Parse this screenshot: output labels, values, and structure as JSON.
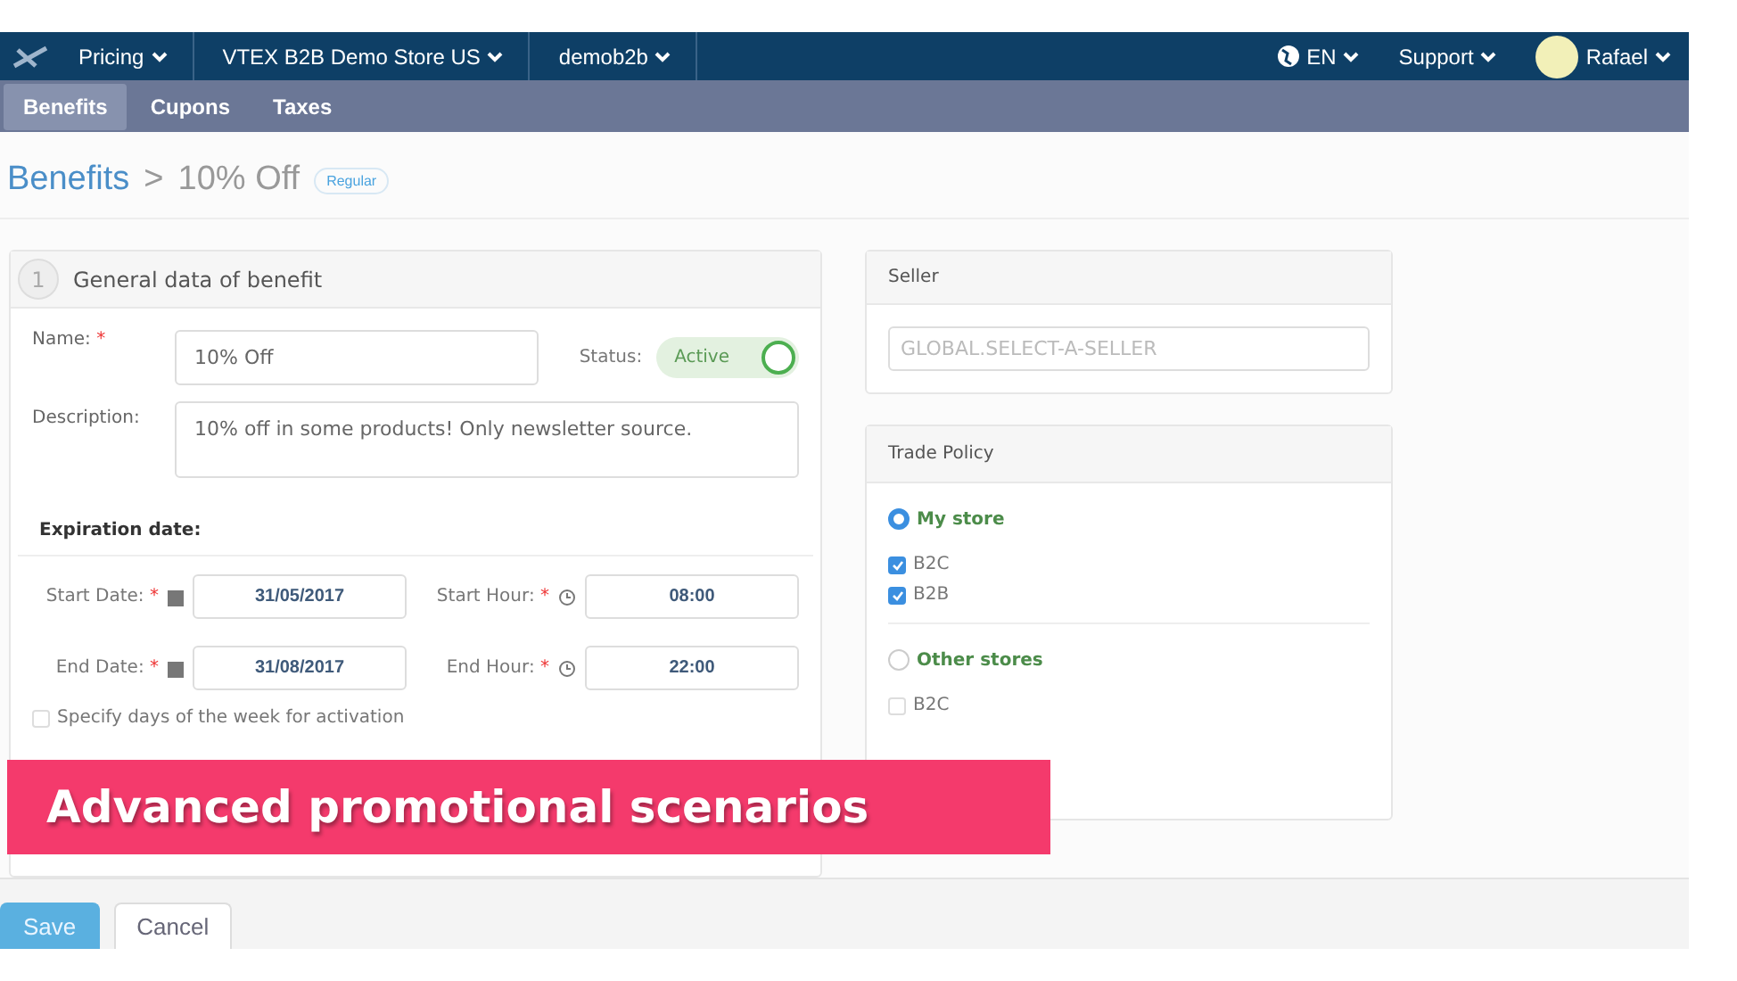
{
  "topbar": {
    "breadcrumbs": [
      {
        "label": "Pricing"
      },
      {
        "label": "VTEX B2B Demo Store US"
      },
      {
        "label": "demob2b"
      }
    ],
    "language": "EN",
    "support": "Support",
    "user": "Rafael"
  },
  "tabs": [
    {
      "label": "Benefits",
      "selected": true
    },
    {
      "label": "Cupons",
      "selected": false
    },
    {
      "label": "Taxes",
      "selected": false
    }
  ],
  "page_title": {
    "section": "Benefits",
    "separator": ">",
    "name": "10% Off",
    "badge": "Regular"
  },
  "general": {
    "step": "1",
    "title": "General data of benefit",
    "name": {
      "label": "Name:",
      "mark": "*",
      "value": "10% Off"
    },
    "status": {
      "label": "Status:",
      "value": "Active",
      "on": true
    },
    "description": {
      "label": "Description:",
      "value": "10% off in some products! Only newsletter source."
    },
    "expiration_title": "Expiration date:",
    "dates": [
      {
        "kind": "date",
        "label": "Start Date:",
        "mark": "*",
        "value": "31/05/2017"
      },
      {
        "kind": "time",
        "label": "Start Hour:",
        "mark": "*",
        "value": "08:00"
      },
      {
        "kind": "date",
        "label": "End Date:",
        "mark": "*",
        "value": "31/08/2017"
      },
      {
        "kind": "time",
        "label": "End Hour:",
        "mark": "*",
        "value": "22:00"
      }
    ],
    "weekdays": {
      "label": "Specify days of the week for activation",
      "checked": false
    }
  },
  "seller": {
    "title": "Seller",
    "placeholder": "GLOBAL.SELECT-A-SELLER"
  },
  "trade_policy": {
    "title": "Trade Policy",
    "groups": [
      {
        "label": "My store",
        "selected": true,
        "items": [
          {
            "label": "B2C",
            "checked": true
          },
          {
            "label": "B2B",
            "checked": true
          }
        ]
      },
      {
        "label": "Other stores",
        "selected": false,
        "items": [
          {
            "label": "B2C",
            "checked": false
          }
        ]
      }
    ]
  },
  "footer": {
    "buttons": [
      {
        "label": "Save",
        "kind": "primary"
      },
      {
        "label": "Cancel",
        "kind": "secondary"
      }
    ]
  },
  "caption": "Advanced promotional scenarios"
}
